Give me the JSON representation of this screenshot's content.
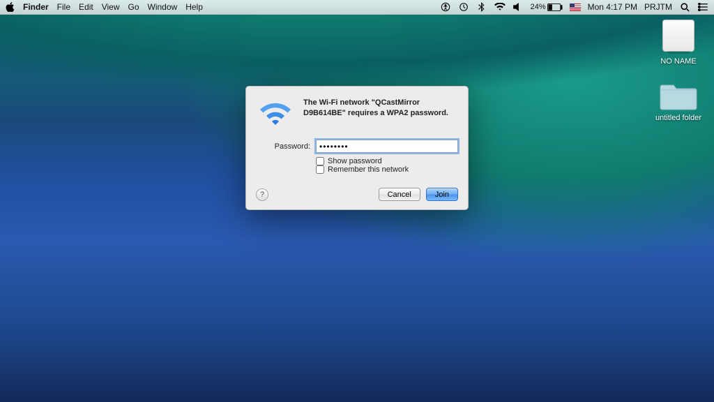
{
  "menubar": {
    "app": "Finder",
    "items": [
      "File",
      "Edit",
      "View",
      "Go",
      "Window",
      "Help"
    ],
    "battery_pct": "24%",
    "clock": "Mon 4:17 PM",
    "user": "PRJTM"
  },
  "desktop_icons": {
    "drive": "NO NAME",
    "folder": "untitled folder"
  },
  "dialog": {
    "message": "The Wi-Fi network \"QCastMirror D9B614BE\" requires a WPA2 password.",
    "password_label": "Password:",
    "password_value": "••••••••",
    "show_password": "Show password",
    "remember": "Remember this network",
    "cancel": "Cancel",
    "join": "Join",
    "help": "?"
  }
}
